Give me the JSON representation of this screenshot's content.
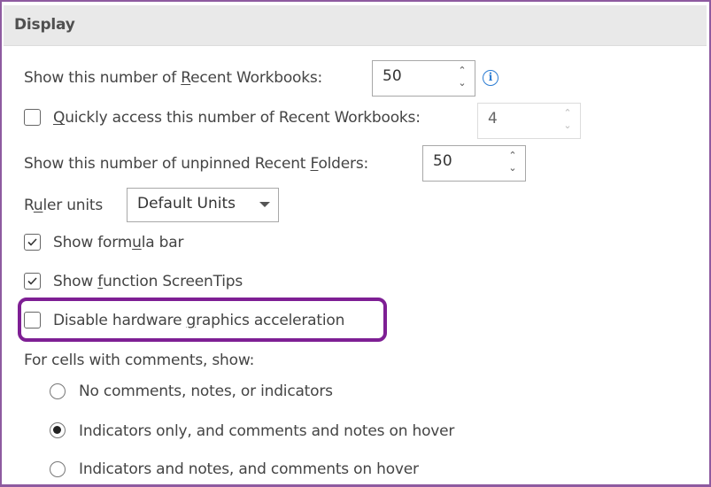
{
  "section": {
    "title": "Display"
  },
  "recent_workbooks": {
    "label_pre": "Show this number of ",
    "label_key": "R",
    "label_post": "ecent Workbooks:",
    "value": "50",
    "info_icon": "info-icon"
  },
  "quick_access": {
    "checked": false,
    "label_key": "Q",
    "label_post": "uickly access this number of Recent Workbooks:",
    "value": "4"
  },
  "recent_folders": {
    "label_pre": "Show this number of unpinned Recent ",
    "label_key": "F",
    "label_post": "olders:",
    "value": "50"
  },
  "ruler_units": {
    "label_pre": "R",
    "label_key": "u",
    "label_post": "ler units",
    "selected": "Default Units"
  },
  "show_formula_bar": {
    "checked": true,
    "label_pre": "Show form",
    "label_key": "u",
    "label_post": "la bar"
  },
  "show_function_screentips": {
    "checked": true,
    "label_pre": "Show ",
    "label_key": "f",
    "label_post": "unction ScreenTips"
  },
  "disable_hw_accel": {
    "checked": false,
    "label_pre": "Disable hardware ",
    "label_key": "g",
    "label_post": "raphics acceleration",
    "highlight_color": "#7e1f94"
  },
  "comments": {
    "label": "For cells with comments, show:",
    "options": [
      {
        "label": "No comments, notes, or indicators",
        "selected": false
      },
      {
        "label": "Indicators only, and comments and notes on hover",
        "selected": true
      },
      {
        "label": "Indicators and notes, and comments on hover",
        "selected": false
      }
    ]
  },
  "colors": {
    "frame_border": "#8e5aa0",
    "header_bg": "#e9e9e9",
    "info_blue": "#2b7cd3"
  }
}
